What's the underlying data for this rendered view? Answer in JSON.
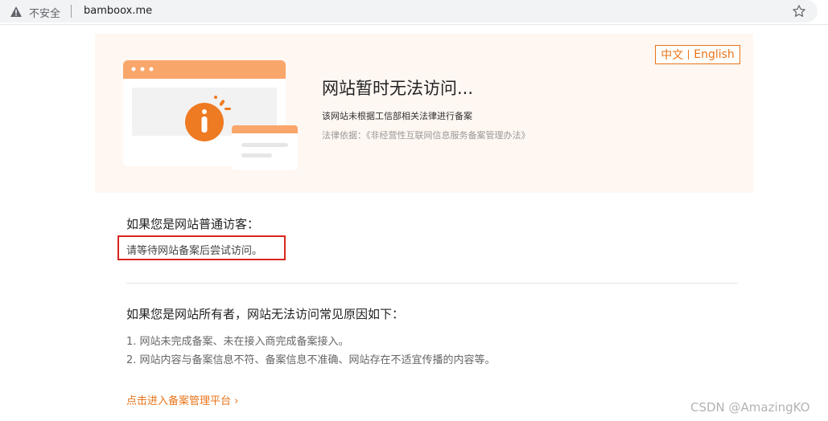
{
  "browser": {
    "security_label": "不安全",
    "url": "bamboox.me"
  },
  "banner": {
    "title": "网站暂时无法访问...",
    "description": "该网站未根据工信部相关法律进行备案",
    "law_basis": "法律依据：《非经营性互联网信息服务备案管理办法》",
    "lang": {
      "zh": "中文",
      "en": "English"
    }
  },
  "visitor": {
    "heading": "如果您是网站普通访客：",
    "text": "请等待网站备案后尝试访问。"
  },
  "owner": {
    "heading": "如果您是网站所有者，网站无法访问常见原因如下：",
    "reasons": [
      "1. 网站未完成备案、未在接入商完成备案接入。",
      "2. 网站内容与备案信息不符、备案信息不准确、网站存在不适宜传播的内容等。"
    ]
  },
  "link": {
    "label": "点击进入备案管理平台 ›"
  },
  "watermark": "CSDN @AmazingKO",
  "icons": [
    "warning-triangle-icon",
    "star-icon",
    "info-icon"
  ],
  "colors": {
    "accent": "#e8741a",
    "highlight": "#d9251d",
    "banner_bg": "#fef7f2"
  }
}
